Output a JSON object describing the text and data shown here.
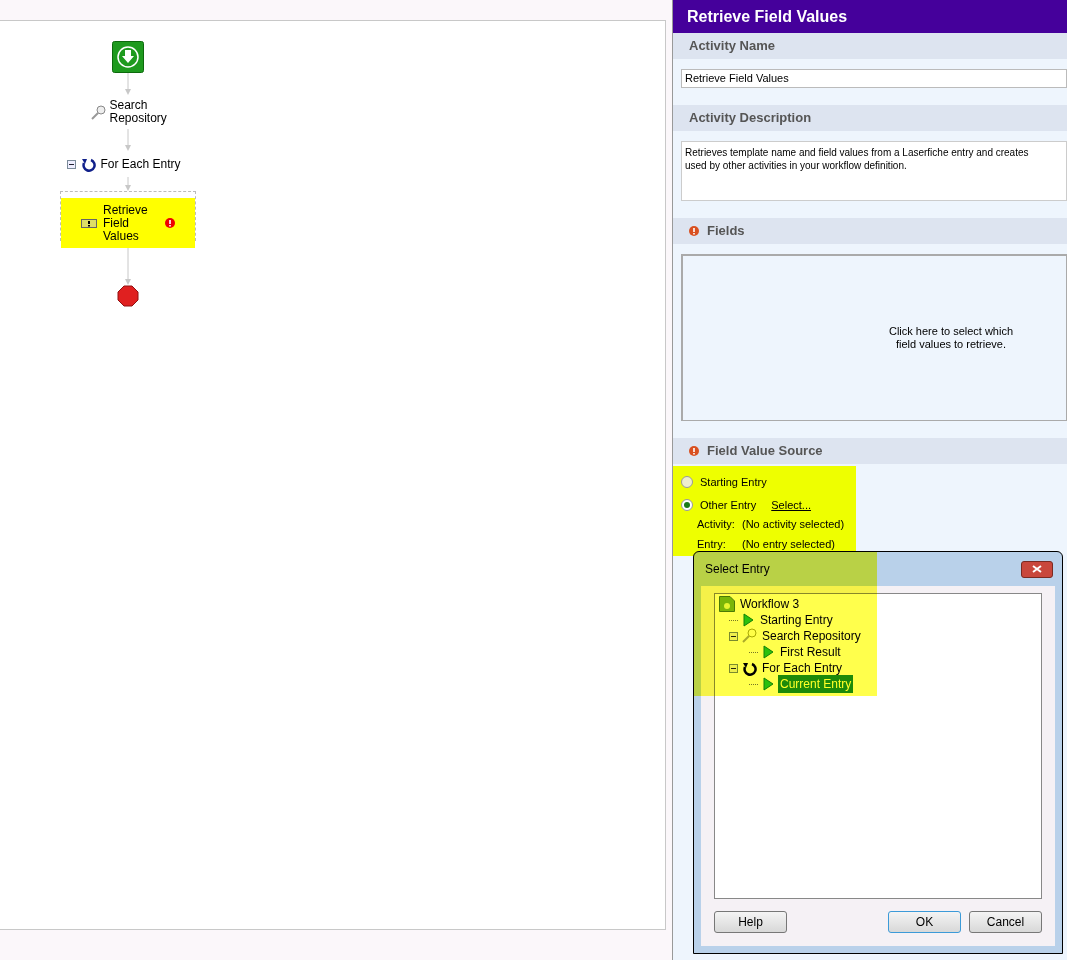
{
  "flow": {
    "nodes": [
      {
        "kind": "start"
      },
      {
        "kind": "search",
        "label": "Search Repository"
      },
      {
        "kind": "loop",
        "label": "For Each Entry",
        "expanded": true
      },
      {
        "kind": "activity",
        "label": "Retrieve Field Values",
        "selected": true,
        "error": true
      },
      {
        "kind": "end"
      }
    ]
  },
  "panel": {
    "title": "Retrieve Field Values",
    "sections": [
      {
        "kind": "text",
        "title": "Activity Name",
        "value": "Retrieve Field Values",
        "error": false
      },
      {
        "kind": "textarea",
        "title": "Activity Description",
        "lines": [
          "Retrieves template name and field values from a Laserfiche entry and creates",
          "used by other activities in your workflow definition."
        ],
        "error": false
      },
      {
        "kind": "picker",
        "title": "Fields",
        "hint": "Click here to select which field values to retrieve.",
        "error": true
      },
      {
        "kind": "source",
        "title": "Field Value Source",
        "error": true,
        "options": [
          {
            "label": "Starting Entry",
            "selected": false
          },
          {
            "label": "Other Entry",
            "selected": true,
            "link": "Select..."
          }
        ],
        "details": [
          {
            "label": "Activity:",
            "value": "(No activity selected)"
          },
          {
            "label": "Entry:",
            "value": "(No entry selected)"
          }
        ]
      }
    ]
  },
  "dialog": {
    "title": "Select Entry",
    "tree": [
      {
        "kind": "workflow",
        "label": "Workflow 3",
        "selected": false,
        "children": [
          {
            "kind": "entry",
            "label": "Starting Entry",
            "selected": false
          },
          {
            "kind": "search",
            "label": "Search Repository",
            "selected": false,
            "expanded": true,
            "children": [
              {
                "kind": "entry",
                "label": "First Result",
                "selected": false
              }
            ]
          },
          {
            "kind": "loop",
            "label": "For Each Entry",
            "selected": false,
            "expanded": true,
            "children": [
              {
                "kind": "entry",
                "label": "Current Entry",
                "selected": true
              }
            ]
          }
        ]
      }
    ],
    "buttons": [
      {
        "label": "Help",
        "default": false
      },
      {
        "label": "OK",
        "default": true
      },
      {
        "label": "Cancel",
        "default": false
      }
    ]
  }
}
